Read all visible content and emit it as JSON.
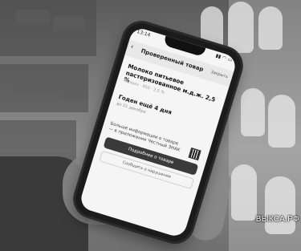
{
  "phone_screen": {
    "time": "13:14",
    "header_title": "Проверенный товар",
    "header_right": "Закрыть",
    "product_title": "Молоко питьевое пастеризованное м.д.ж. 2,5 %",
    "meta": "Молоко · 950 · 2,5 %",
    "expiry": "Годен ещё 4 дня",
    "expiry_sub": "до 21 декабря",
    "more_info": "Больше информации о товаре — в приложении Честный ЗНАК",
    "primary_button": "Подробнее о товаре",
    "secondary_button": "Сообщить о нарушении"
  },
  "watermark": "ВЫКСА.РФ"
}
